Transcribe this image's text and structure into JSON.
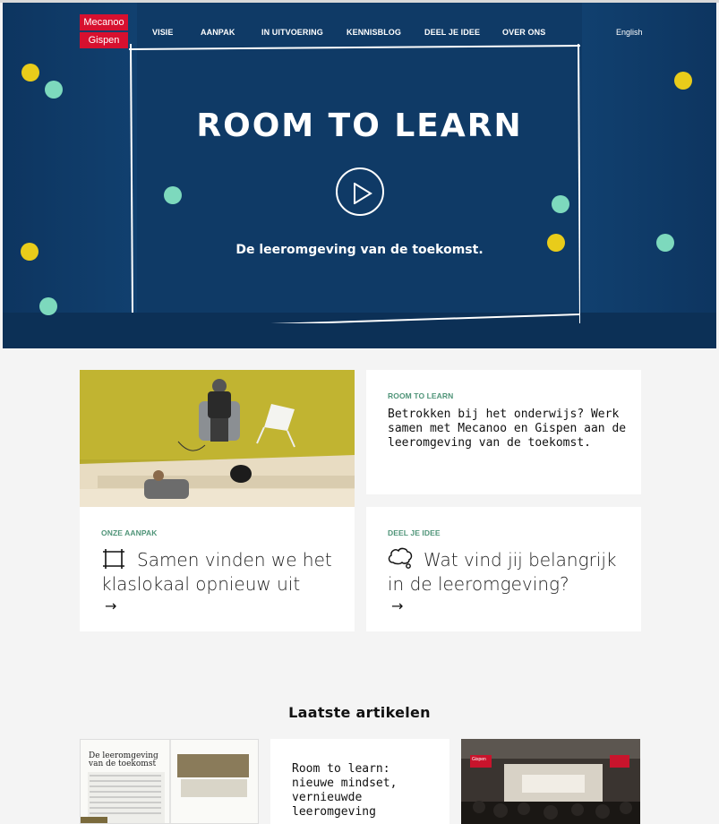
{
  "logo": {
    "line1": "Mecanoo",
    "line2": "Gispen"
  },
  "nav": [
    "VISIE",
    "AANPAK",
    "IN UITVOERING",
    "KENNISBLOG",
    "DEEL JE IDEE",
    "OVER ONS"
  ],
  "language": "English",
  "hero": {
    "title": "ROOM TO LEARN",
    "subtitle": "De leeromgeving van de toekomst."
  },
  "intro_card": {
    "kicker": "ROOM TO LEARN",
    "text": "Betrokken bij het onderwijs? Werk samen met Mecanoo en Gispen aan de leeromgeving van de toekomst."
  },
  "approach_card": {
    "kicker": "ONZE AANPAK",
    "text": "Samen vinden we het klaslokaal opnieuw uit",
    "arrow": "→"
  },
  "idea_card": {
    "kicker": "DEEL JE IDEE",
    "text": "Wat vind jij belangrijk in de leeromgeving?",
    "arrow": "→"
  },
  "latest": {
    "title": "Laatste artikelen",
    "article_heading": "De leeromgeving van de toekomst",
    "article_2_title": "Room to learn: nieuwe mindset, vernieuwde leeromgeving",
    "booth_sign": "Gispen"
  },
  "colors": {
    "hero_blue": "#0f3a66",
    "logo_red": "#d7102f",
    "kicker_green": "#4f9478",
    "dot_yellow": "#e9cc1a",
    "dot_mint": "#7dd9bd"
  }
}
